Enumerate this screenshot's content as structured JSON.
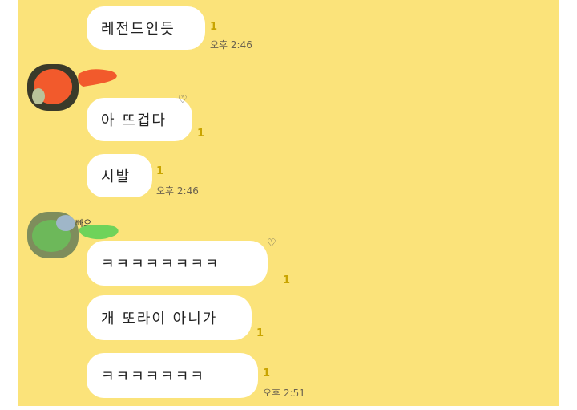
{
  "messages": [
    {
      "text": "레전드인듯",
      "unread": "1",
      "time": "오후 2:46"
    },
    {
      "text": "아 뜨겁다",
      "unread": "1"
    },
    {
      "text": "시발",
      "unread": "1",
      "time": "오후 2:46"
    },
    {
      "text": "ㅋㅋㅋㅋㅋㅋㅋㅋ",
      "unread": "1"
    },
    {
      "text": "개 또라이 아니가",
      "unread": "1"
    },
    {
      "text": "ㅋㅋㅋㅋㅋㅋㅋ",
      "unread": "1",
      "time": "오후 2:51"
    }
  ],
  "sender2_name_fragment": "빠으",
  "icons": {
    "reaction": "heart-reaction-icon"
  },
  "colors": {
    "chat_bg": "#fbe37a",
    "bubble": "#ffffff",
    "unread": "#c9a400"
  }
}
